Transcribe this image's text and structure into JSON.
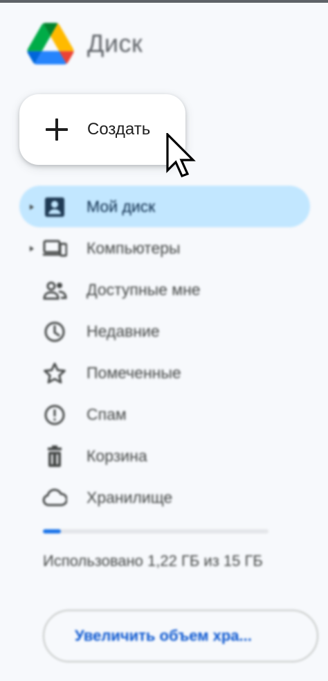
{
  "app": {
    "title": "Диск",
    "logo_icon": "google-drive-logo",
    "colors": {
      "green": "#1ea362",
      "yellow": "#ffba00",
      "blue": "#2684fc",
      "red": "#ea4335",
      "accent_bg": "#c2e7ff"
    }
  },
  "create": {
    "label": "Создать",
    "icon": "plus-icon"
  },
  "nav": {
    "items": [
      {
        "label": "Мой диск",
        "icon": "my-drive-icon",
        "expandable": true,
        "active": true
      },
      {
        "label": "Компьютеры",
        "icon": "computers-icon",
        "expandable": true,
        "active": false
      },
      {
        "label": "Доступные мне",
        "icon": "shared-with-me-icon",
        "expandable": false,
        "active": false
      },
      {
        "label": "Недавние",
        "icon": "clock-icon",
        "expandable": false,
        "active": false
      },
      {
        "label": "Помеченные",
        "icon": "star-icon",
        "expandable": false,
        "active": false
      },
      {
        "label": "Спам",
        "icon": "spam-icon",
        "expandable": false,
        "active": false
      },
      {
        "label": "Корзина",
        "icon": "trash-icon",
        "expandable": false,
        "active": false
      },
      {
        "label": "Хранилище",
        "icon": "cloud-icon",
        "expandable": false,
        "active": false
      }
    ]
  },
  "storage": {
    "used_fraction": 0.08,
    "text": "Использовано 1,22 ГБ из 15 ГБ",
    "upgrade_label": "Увеличить объем хра..."
  }
}
